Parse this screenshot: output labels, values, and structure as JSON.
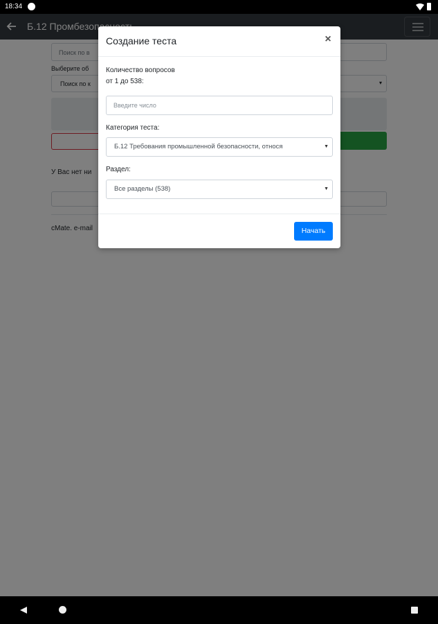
{
  "status_bar": {
    "time": "18:34"
  },
  "app_bar": {
    "title": "Б.12 Промбезопасность"
  },
  "background": {
    "search_placeholder": "Поиск по в",
    "select_label": "Выберите об",
    "select_value": "Поиск по к",
    "message": "У Вас нет ни",
    "footer": "cMate. e-mail"
  },
  "modal": {
    "title": "Создание теста",
    "close_label": "×",
    "questions_label_line1": "Количество вопросов",
    "questions_label_line2": "от 1 до 538:",
    "questions_placeholder": "Введите число",
    "category_label": "Категория теста:",
    "category_value": "Б.12 Требования промышленной безопасности, относя",
    "section_label": "Раздел:",
    "section_value": "Все разделы (538)",
    "start_button": "Начать"
  }
}
